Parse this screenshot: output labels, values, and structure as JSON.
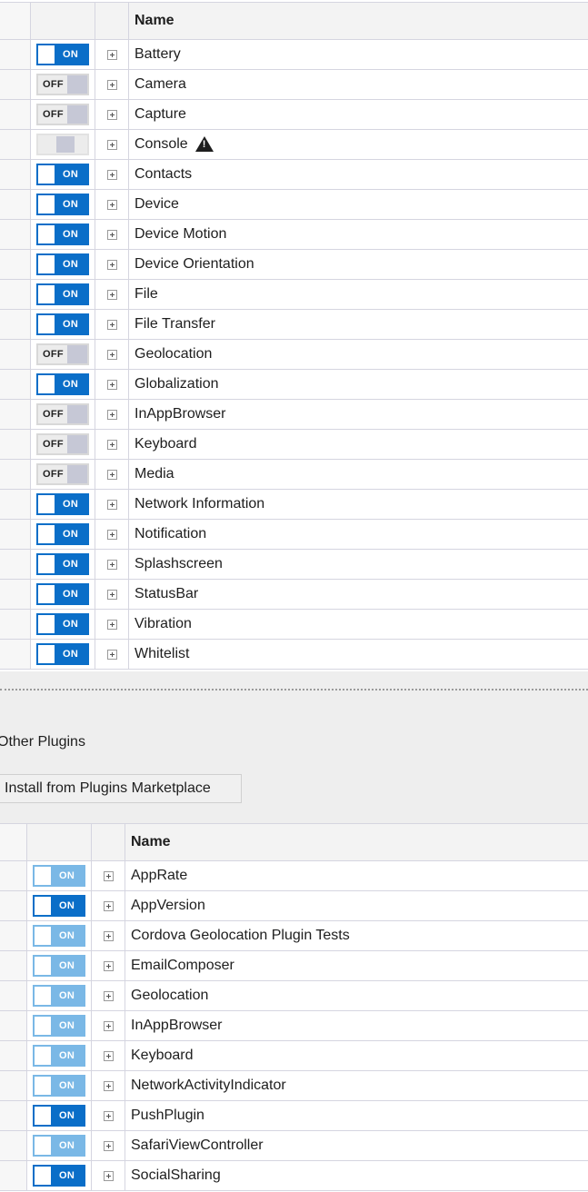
{
  "core_table": {
    "header_name": "Name",
    "rows": [
      {
        "name": "Battery",
        "state": "on",
        "toggle_label": "ON"
      },
      {
        "name": "Camera",
        "state": "off",
        "toggle_label": "OFF"
      },
      {
        "name": "Capture",
        "state": "off",
        "toggle_label": "OFF"
      },
      {
        "name": "Console",
        "state": "blank",
        "toggle_label": "",
        "warning": true
      },
      {
        "name": "Contacts",
        "state": "on",
        "toggle_label": "ON"
      },
      {
        "name": "Device",
        "state": "on",
        "toggle_label": "ON"
      },
      {
        "name": "Device Motion",
        "state": "on",
        "toggle_label": "ON"
      },
      {
        "name": "Device Orientation",
        "state": "on",
        "toggle_label": "ON"
      },
      {
        "name": "File",
        "state": "on",
        "toggle_label": "ON"
      },
      {
        "name": "File Transfer",
        "state": "on",
        "toggle_label": "ON"
      },
      {
        "name": "Geolocation",
        "state": "off",
        "toggle_label": "OFF"
      },
      {
        "name": "Globalization",
        "state": "on",
        "toggle_label": "ON"
      },
      {
        "name": "InAppBrowser",
        "state": "off",
        "toggle_label": "OFF"
      },
      {
        "name": "Keyboard",
        "state": "off",
        "toggle_label": "OFF"
      },
      {
        "name": "Media",
        "state": "off",
        "toggle_label": "OFF"
      },
      {
        "name": "Network Information",
        "state": "on",
        "toggle_label": "ON"
      },
      {
        "name": "Notification",
        "state": "on",
        "toggle_label": "ON"
      },
      {
        "name": "Splashscreen",
        "state": "on",
        "toggle_label": "ON"
      },
      {
        "name": "StatusBar",
        "state": "on",
        "toggle_label": "ON"
      },
      {
        "name": "Vibration",
        "state": "on",
        "toggle_label": "ON"
      },
      {
        "name": "Whitelist",
        "state": "on",
        "toggle_label": "ON"
      }
    ]
  },
  "other_plugins": {
    "section_title": "Other Plugins",
    "install_button_label": "Install from Plugins Marketplace"
  },
  "other_table": {
    "header_name": "Name",
    "rows": [
      {
        "name": "AppRate",
        "state": "light",
        "toggle_label": "ON"
      },
      {
        "name": "AppVersion",
        "state": "on",
        "toggle_label": "ON"
      },
      {
        "name": "Cordova Geolocation Plugin Tests",
        "state": "light",
        "toggle_label": "ON"
      },
      {
        "name": "EmailComposer",
        "state": "light",
        "toggle_label": "ON"
      },
      {
        "name": "Geolocation",
        "state": "light",
        "toggle_label": "ON"
      },
      {
        "name": "InAppBrowser",
        "state": "light",
        "toggle_label": "ON"
      },
      {
        "name": "Keyboard",
        "state": "light",
        "toggle_label": "ON"
      },
      {
        "name": "NetworkActivityIndicator",
        "state": "light",
        "toggle_label": "ON"
      },
      {
        "name": "PushPlugin",
        "state": "on",
        "toggle_label": "ON"
      },
      {
        "name": "SafariViewController",
        "state": "light",
        "toggle_label": "ON"
      },
      {
        "name": "SocialSharing",
        "state": "on",
        "toggle_label": "ON"
      }
    ]
  }
}
